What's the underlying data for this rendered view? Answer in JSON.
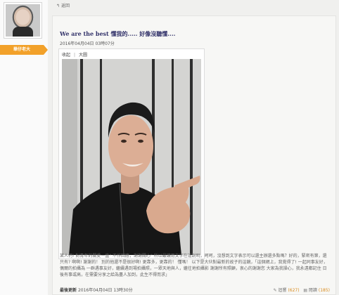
{
  "sidebar": {
    "name_tag": "華仔老大"
  },
  "nav": {
    "back_label": "返回"
  },
  "post": {
    "title": "We are the best 懂我的..... 好像沒聽懂....",
    "date": "2016年04月04日 03時07分",
    "toolbar": {
      "small_label": "收起",
      "large_label": "大圖"
    },
    "body": "某人們! 對青年的關愛一直\" 不作回應，謝謝關心\" 所以最讓用文字在這說明，呵呵，沒想到文字表示可以還主辦還多點嗎？好的，緊密有第，還只有? 啊啊! 謝謝的！ 別的他還不是很好啊! 更靠多，更靠的！ 懂嗎！ 以下是大伙對最新的故子的這鏡，「這個網上，我覺得了! 一起同事友好，偶爾的拍攝為 一群遇事友好，繼續遇到場拍攝照，一眾天地與人，繼往地拍攝影 謝謝所有照顧，衷心的謝謝您 大家為我操心，我永遠都記住 日後有事或高，在需要分享之給為盡人加到，此生不得而求」",
    "footer": {
      "time_label": "最後更新",
      "time_value": "2016年04月04日 13時30分",
      "comments_label": "迴響",
      "comments_count": "(627)",
      "views_label": "閱讀",
      "views_count": "(185)"
    }
  },
  "colors": {
    "name_tag_bg": "#f2a12a",
    "title_text": "#33336a"
  }
}
